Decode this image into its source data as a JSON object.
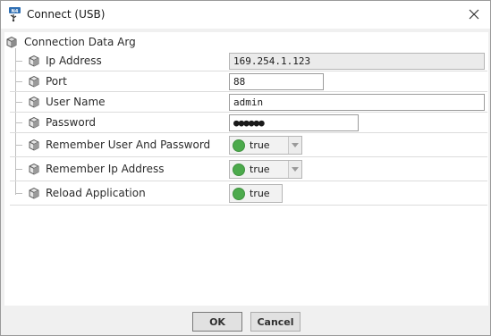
{
  "window": {
    "title": "Connect (USB)",
    "app_icon": "niagara-usb-icon",
    "close_icon": "close-icon"
  },
  "tree": {
    "root_label": "Connection Data Arg",
    "properties": [
      {
        "label": "Ip Address",
        "type": "text",
        "value": "169.254.1.123",
        "readonly": true
      },
      {
        "label": "Port",
        "type": "text",
        "value": "88"
      },
      {
        "label": "User Name",
        "type": "text",
        "value": "admin"
      },
      {
        "label": "Password",
        "type": "password",
        "value": "●●●●●●"
      },
      {
        "label": "Remember User And Password",
        "type": "boolean-select",
        "value": "true"
      },
      {
        "label": "Remember Ip Address",
        "type": "boolean-select",
        "value": "true"
      },
      {
        "label": "Reload Application",
        "type": "boolean",
        "value": "true"
      }
    ]
  },
  "buttons": {
    "ok": "OK",
    "cancel": "Cancel"
  },
  "colors": {
    "true_indicator": "#4caa4c",
    "background": "#f0f0f0"
  }
}
